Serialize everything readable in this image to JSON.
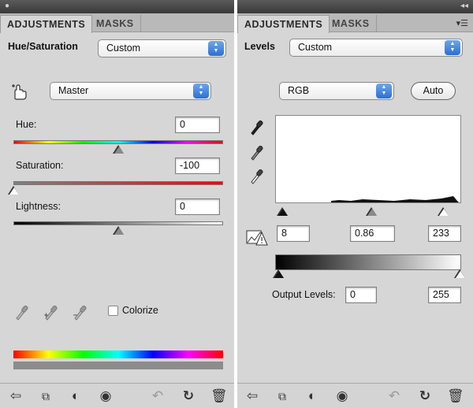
{
  "left_panel": {
    "tabs": {
      "active": "ADJUSTMENTS",
      "inactive": "MASKS"
    },
    "adjustment_label": "Hue/Saturation",
    "preset_select": "Custom",
    "channel_select": "Master",
    "hue": {
      "label": "Hue:",
      "value": "0",
      "level": 0.5
    },
    "saturation": {
      "label": "Saturation:",
      "value": "-100",
      "level": 0.0
    },
    "lightness": {
      "label": "Lightness:",
      "value": "0",
      "level": 0.5
    },
    "colorize": {
      "label": "Colorize",
      "checked": false
    }
  },
  "right_panel": {
    "tabs": {
      "active": "ADJUSTMENTS",
      "inactive": "MASKS"
    },
    "adjustment_label": "Levels",
    "preset_select": "Custom",
    "channel_select": "RGB",
    "auto_button": "Auto",
    "input_levels": {
      "black": "8",
      "gamma": "0.86",
      "white": "233"
    },
    "output_label": "Output Levels:",
    "output_levels": {
      "black": "0",
      "white": "255"
    }
  },
  "bottom_icons": [
    "back-arrow-icon",
    "clip-to-layer-icon",
    "visibility-toggle-icon",
    "eye-icon",
    "previous-state-icon",
    "reset-icon",
    "trash-icon"
  ]
}
